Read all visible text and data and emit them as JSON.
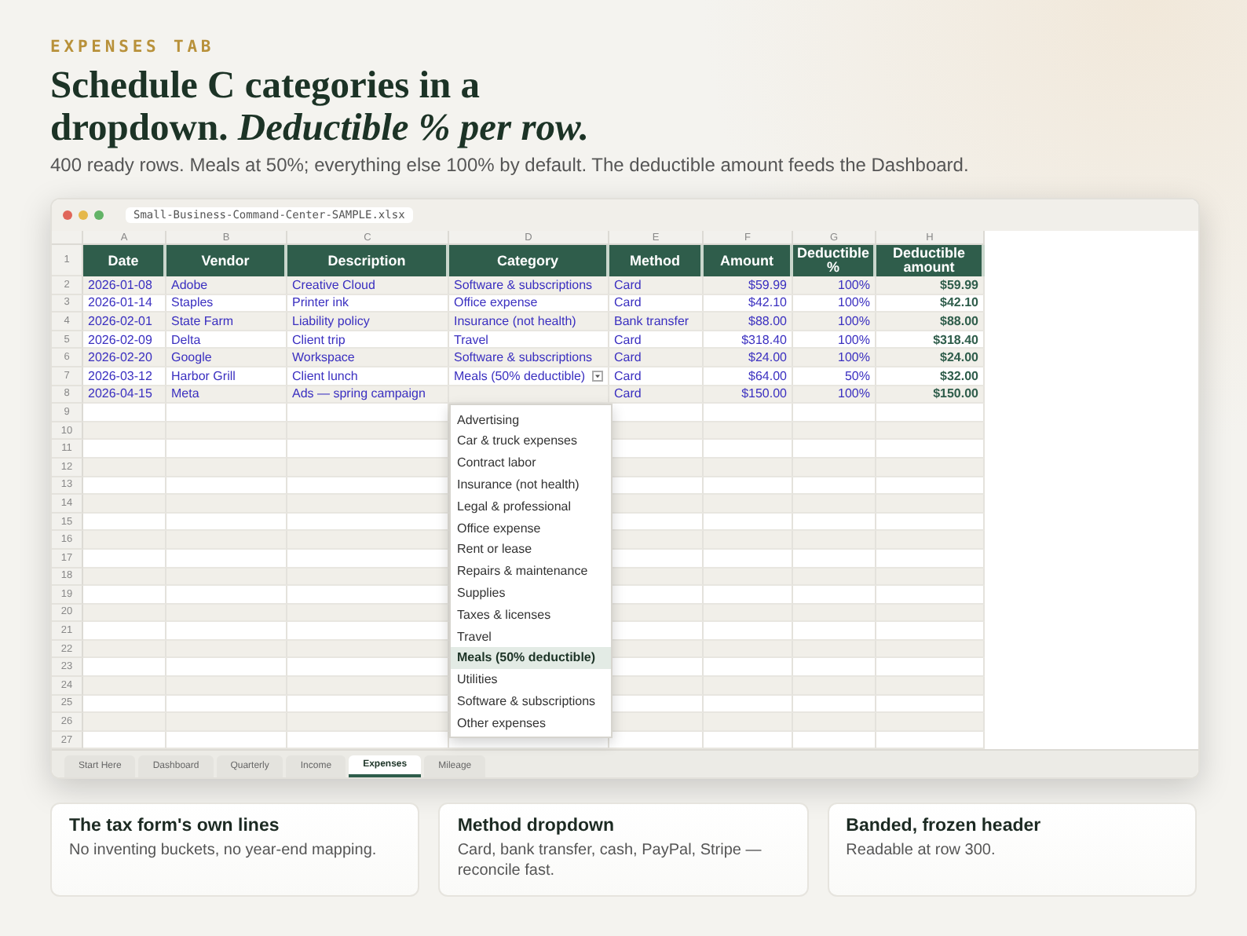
{
  "eyebrow": "EXPENSES TAB",
  "headline": "Schedule C categories in a dropdown. *Deductible % per row.*",
  "subtitle": "400 ready rows. Meals at 50%; everything else 100% by default. The deductible amount feeds the Dashboard.",
  "window": {
    "file_name": "Small-Business-Command-Center-SAMPLE.xlsx"
  },
  "sheet": {
    "columns": [
      {
        "letter": "A",
        "heading": "Date",
        "kind": "text"
      },
      {
        "letter": "B",
        "heading": "Vendor",
        "kind": "text"
      },
      {
        "letter": "C",
        "heading": "Description",
        "kind": "text"
      },
      {
        "letter": "D",
        "heading": "Category",
        "kind": "text"
      },
      {
        "letter": "E",
        "heading": "Method",
        "kind": "text"
      },
      {
        "letter": "F",
        "heading": "Amount",
        "kind": "number"
      },
      {
        "letter": "G",
        "heading": "Deductible %",
        "kind": "number"
      },
      {
        "letter": "H",
        "heading": "Deductible amount",
        "kind": "formula"
      }
    ],
    "header_row_number": "1",
    "rows": [
      {
        "number": "2",
        "cells": [
          "2026-01-08",
          "Adobe",
          "Creative Cloud",
          "Software & subscriptions",
          "Card",
          "$59.99",
          "100%",
          "$59.99"
        ],
        "active": false
      },
      {
        "number": "3",
        "cells": [
          "2026-01-14",
          "Staples",
          "Printer ink",
          "Office expense",
          "Card",
          "$42.10",
          "100%",
          "$42.10"
        ],
        "active": false
      },
      {
        "number": "4",
        "cells": [
          "2026-02-01",
          "State Farm",
          "Liability policy",
          "Insurance (not health)",
          "Bank transfer",
          "$88.00",
          "100%",
          "$88.00"
        ],
        "active": false
      },
      {
        "number": "5",
        "cells": [
          "2026-02-09",
          "Delta",
          "Client trip",
          "Travel",
          "Card",
          "$318.40",
          "100%",
          "$318.40"
        ],
        "active": false
      },
      {
        "number": "6",
        "cells": [
          "2026-02-20",
          "Google",
          "Workspace",
          "Software & subscriptions",
          "Card",
          "$24.00",
          "100%",
          "$24.00"
        ],
        "active": false
      },
      {
        "number": "7",
        "cells": [
          "2026-03-12",
          "Harbor Grill",
          "Client lunch",
          "Meals (50% deductible)",
          "Card",
          "$64.00",
          "50%",
          "$32.00"
        ],
        "active": true
      },
      {
        "number": "8",
        "cells": [
          "2026-04-15",
          "Meta",
          "Ads — spring campaign",
          "",
          "Card",
          "$150.00",
          "100%",
          "$150.00"
        ],
        "active": false
      }
    ],
    "empty_row_numbers": [
      "9",
      "10",
      "11",
      "12",
      "13",
      "14",
      "15",
      "16",
      "17",
      "18",
      "19",
      "20",
      "21",
      "22",
      "23",
      "24",
      "25",
      "26",
      "27"
    ],
    "dropdown": [
      {
        "label": "Advertising",
        "selected": false
      },
      {
        "label": "Car & truck expenses",
        "selected": false
      },
      {
        "label": "Contract labor",
        "selected": false
      },
      {
        "label": "Insurance (not health)",
        "selected": false
      },
      {
        "label": "Legal & professional",
        "selected": false
      },
      {
        "label": "Office expense",
        "selected": false
      },
      {
        "label": "Rent or lease",
        "selected": false
      },
      {
        "label": "Repairs & maintenance",
        "selected": false
      },
      {
        "label": "Supplies",
        "selected": false
      },
      {
        "label": "Taxes & licenses",
        "selected": false
      },
      {
        "label": "Travel",
        "selected": false
      },
      {
        "label": "Meals (50% deductible)",
        "selected": true
      },
      {
        "label": "Utilities",
        "selected": false
      },
      {
        "label": "Software & subscriptions",
        "selected": false
      },
      {
        "label": "Other expenses",
        "selected": false
      }
    ]
  },
  "sheet_tabs": [
    {
      "label": "Start Here",
      "selected": false
    },
    {
      "label": "Dashboard",
      "selected": false
    },
    {
      "label": "Quarterly",
      "selected": false
    },
    {
      "label": "Income",
      "selected": false
    },
    {
      "label": "Expenses",
      "selected": true
    },
    {
      "label": "Mileage",
      "selected": false
    }
  ],
  "cards": [
    {
      "title": "The tax form's own lines",
      "text": "No inventing buckets, no year-end mapping."
    },
    {
      "title": "Method dropdown",
      "text": "Card, bank transfer, cash, PayPal, Stripe — reconcile fast."
    },
    {
      "title": "Banded, frozen header",
      "text": "Readable at row 300."
    }
  ]
}
